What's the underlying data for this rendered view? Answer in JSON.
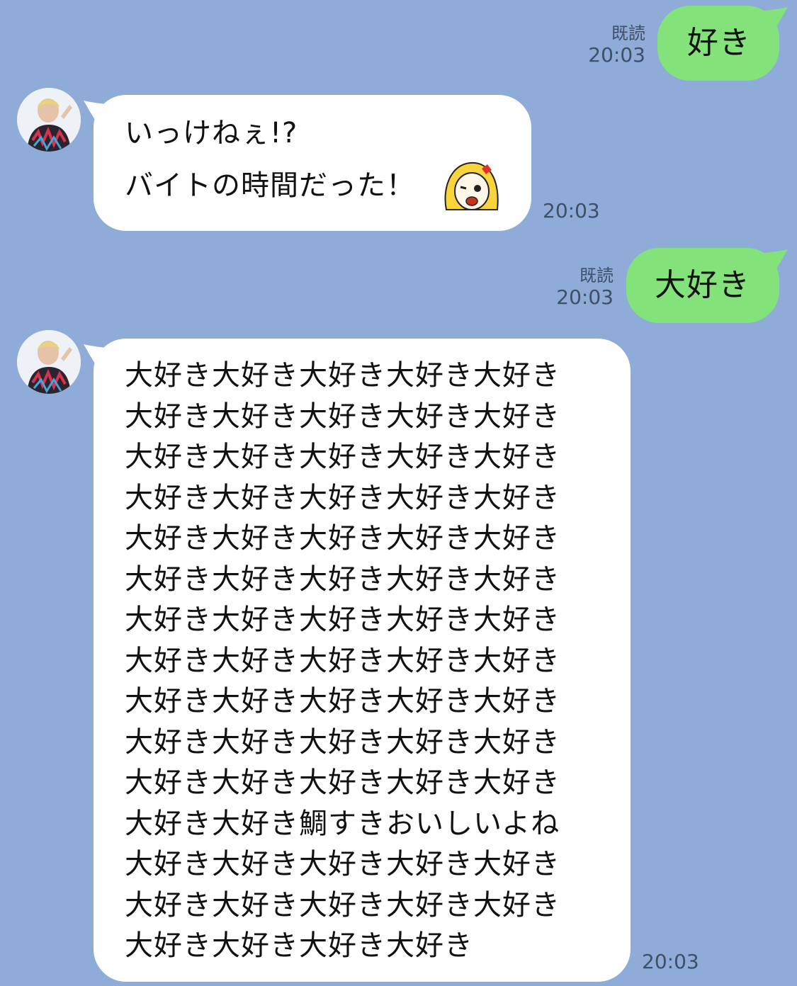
{
  "messages": [
    {
      "direction": "outgoing",
      "text": "好き",
      "read_label": "既読",
      "time": "20:03"
    },
    {
      "direction": "incoming",
      "lines": [
        "いっけねぇ!?",
        "バイトの時間だった！"
      ],
      "has_sticker": true,
      "sticker_icon": "surprised-girl-emoji-icon",
      "time": "20:03"
    },
    {
      "direction": "outgoing",
      "text": "大好き",
      "read_label": "既読",
      "time": "20:03"
    },
    {
      "direction": "incoming",
      "lines": [
        "大好き大好き大好き大好き大好き",
        "大好き大好き大好き大好き大好き",
        "大好き大好き大好き大好き大好き",
        "大好き大好き大好き大好き大好き",
        "大好き大好き大好き大好き大好き",
        "大好き大好き大好き大好き大好き",
        "大好き大好き大好き大好き大好き",
        "大好き大好き大好き大好き大好き",
        "大好き大好き大好き大好き大好き",
        "大好き大好き大好き大好き大好き",
        "大好き大好き大好き大好き大好き",
        "大好き大好き鯛すきおいしいよね",
        "大好き大好き大好き大好き大好き",
        "大好き大好き大好き大好き大好き",
        "大好き大好き大好き大好き"
      ],
      "time": "20:03"
    }
  ],
  "colors": {
    "background": "#8fabd8",
    "outgoing_bubble": "#84e27b",
    "incoming_bubble": "#ffffff",
    "meta_text": "#3e4f66"
  }
}
